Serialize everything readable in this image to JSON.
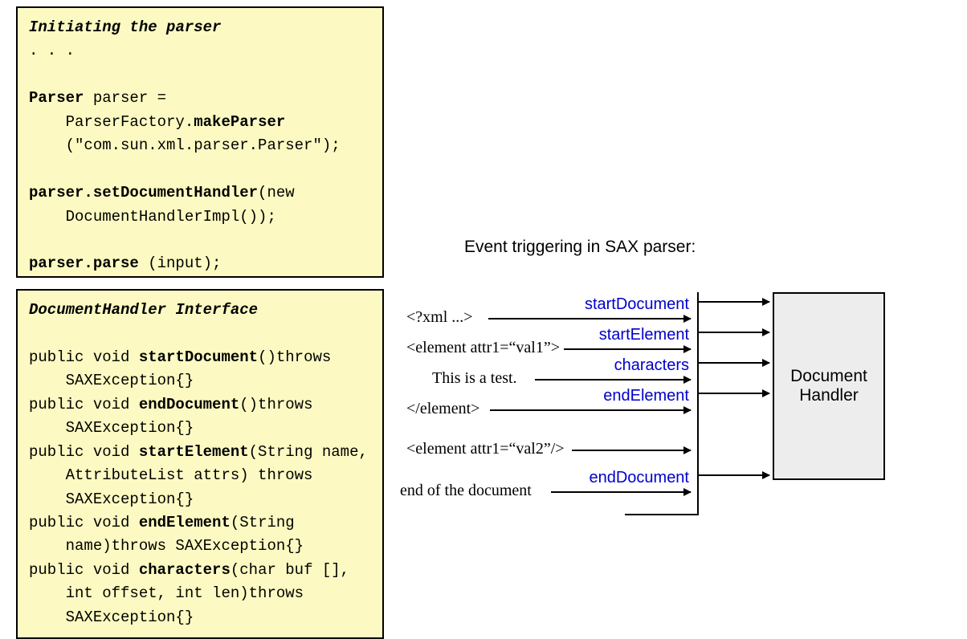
{
  "box1": {
    "title": "Initiating",
    "title_rest": " the parser",
    "ellipsis": ". . .",
    "l1a": "Parser",
    "l1b": " parser =",
    "l2a": "    ParserFactory.",
    "l2b": "makeParser",
    "l3": "    (\"com.sun.xml.parser.Parser\");",
    "sp": "",
    "l4a": "parser.setDocumentHandler",
    "l4b": "(new",
    "l5": "    DocumentHandlerImpl());",
    "l6a": "parser.parse",
    "l6b": " (input);"
  },
  "box2": {
    "title": "DocumentHandler Interface",
    "l1a": "public void ",
    "l1b": "startDocument",
    "l1c": "()throws",
    "l2": "    SAXException{}",
    "l3a": "public void ",
    "l3b": "endDocument",
    "l3c": "()throws",
    "l4": "    SAXException{}",
    "l5a": "public void ",
    "l5b": "startElement",
    "l5c": "(String name,",
    "l6": "    AttributeList attrs) throws",
    "l7": "    SAXException{}",
    "l8a": "public void ",
    "l8b": "endElement",
    "l8c": "(String",
    "l9": "    name)throws SAXException{}",
    "l10a": "public void ",
    "l10b": "characters",
    "l10c": "(char buf [],",
    "l11": "    int offset, int len)throws",
    "l12": "    SAXException{}"
  },
  "diagram": {
    "title": "Event triggering in SAX parser:",
    "handler_box_l1": "Document",
    "handler_box_l2": "Handler",
    "events": {
      "e1": "startDocument",
      "e2": "startElement",
      "e3": "characters",
      "e4": "endElement",
      "e5": "endDocument"
    },
    "xml": {
      "x1": "<?xml ...>",
      "x2": "<element attr1=“val1”>",
      "x3": "This is a test.",
      "x4": "</element>",
      "x5": "<element attr1=“val2”/>",
      "x6": "end of the document"
    }
  }
}
